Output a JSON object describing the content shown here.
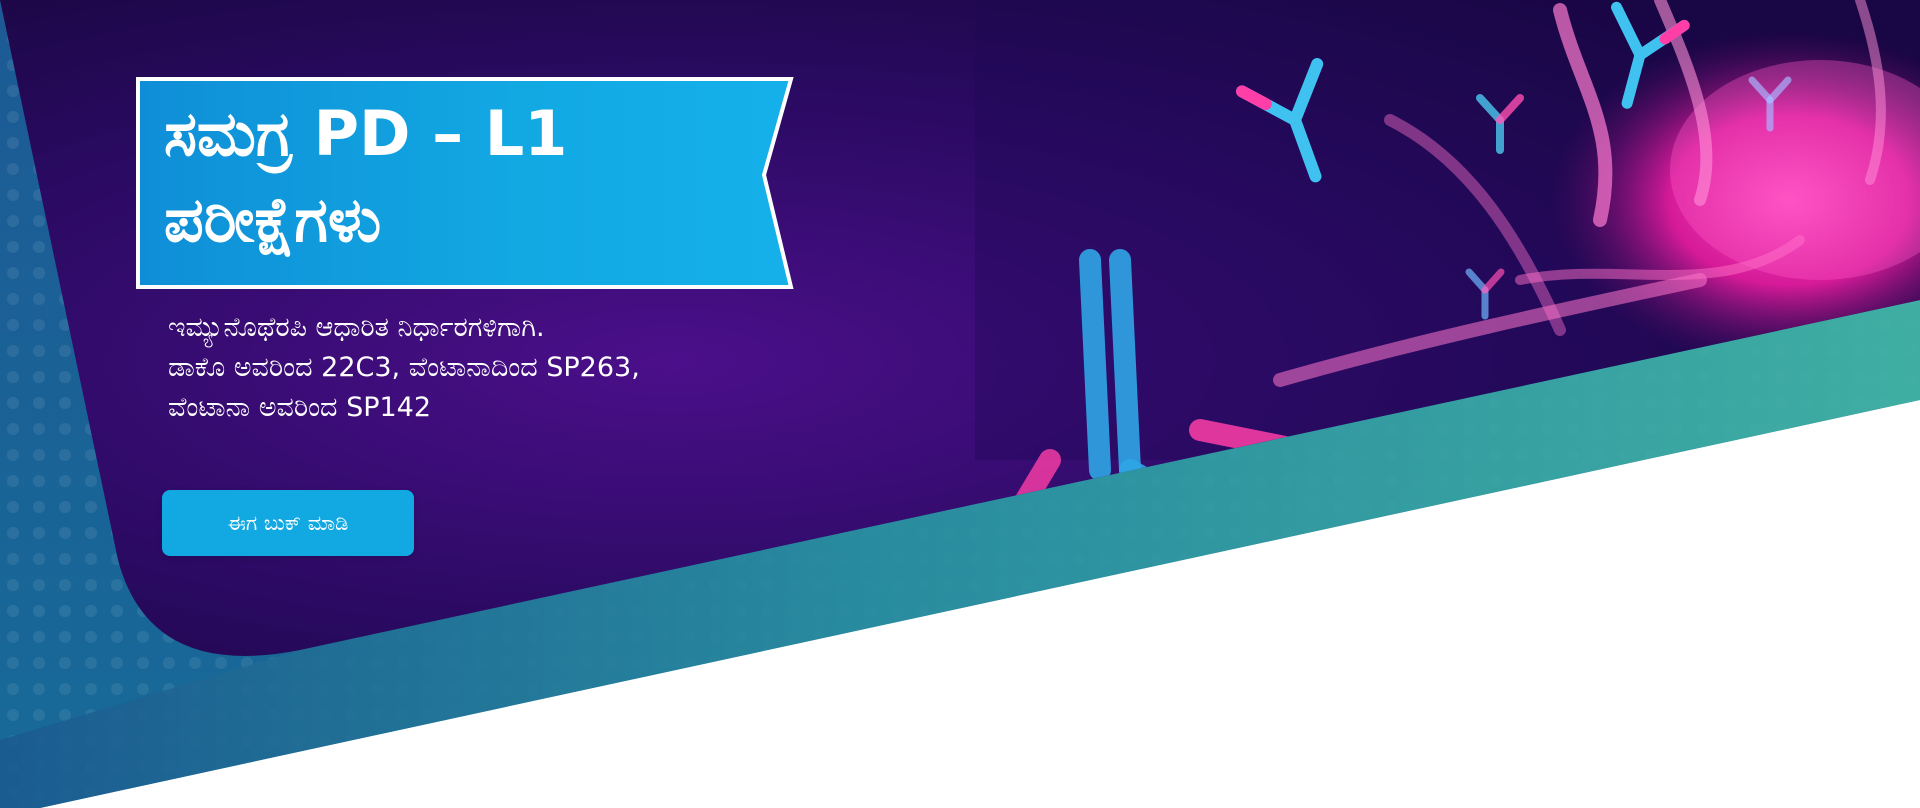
{
  "hero": {
    "title": "ಸಮಗ್ರ PD – L1\nಪರೀಕ್ಷೆಗಳು",
    "subtitle_lines": [
      "ಇಮ್ಯುನೊಥೆರಪಿ ಆಧಾರಿತ ನಿರ್ಧಾರಗಳಿಗಾಗಿ.",
      "ಡಾಕೊ ಅವರಿಂದ 22C3, ವೆಂಟಾನಾದಿಂದ SP263,",
      "ವೆಂಟಾನಾ ಅವರಿಂದ SP142"
    ],
    "cta_label": "ಈಗ ಬುಕ್ ಮಾಡಿ"
  },
  "colors": {
    "banner_blue": "#12a9e3",
    "teal": "#3fb3a5",
    "navy_edge": "#1b4f86",
    "purple_dark": "#1e0748",
    "magenta": "#e0219d"
  },
  "icons": [
    "antibody-icon",
    "tumor-cell-image"
  ]
}
